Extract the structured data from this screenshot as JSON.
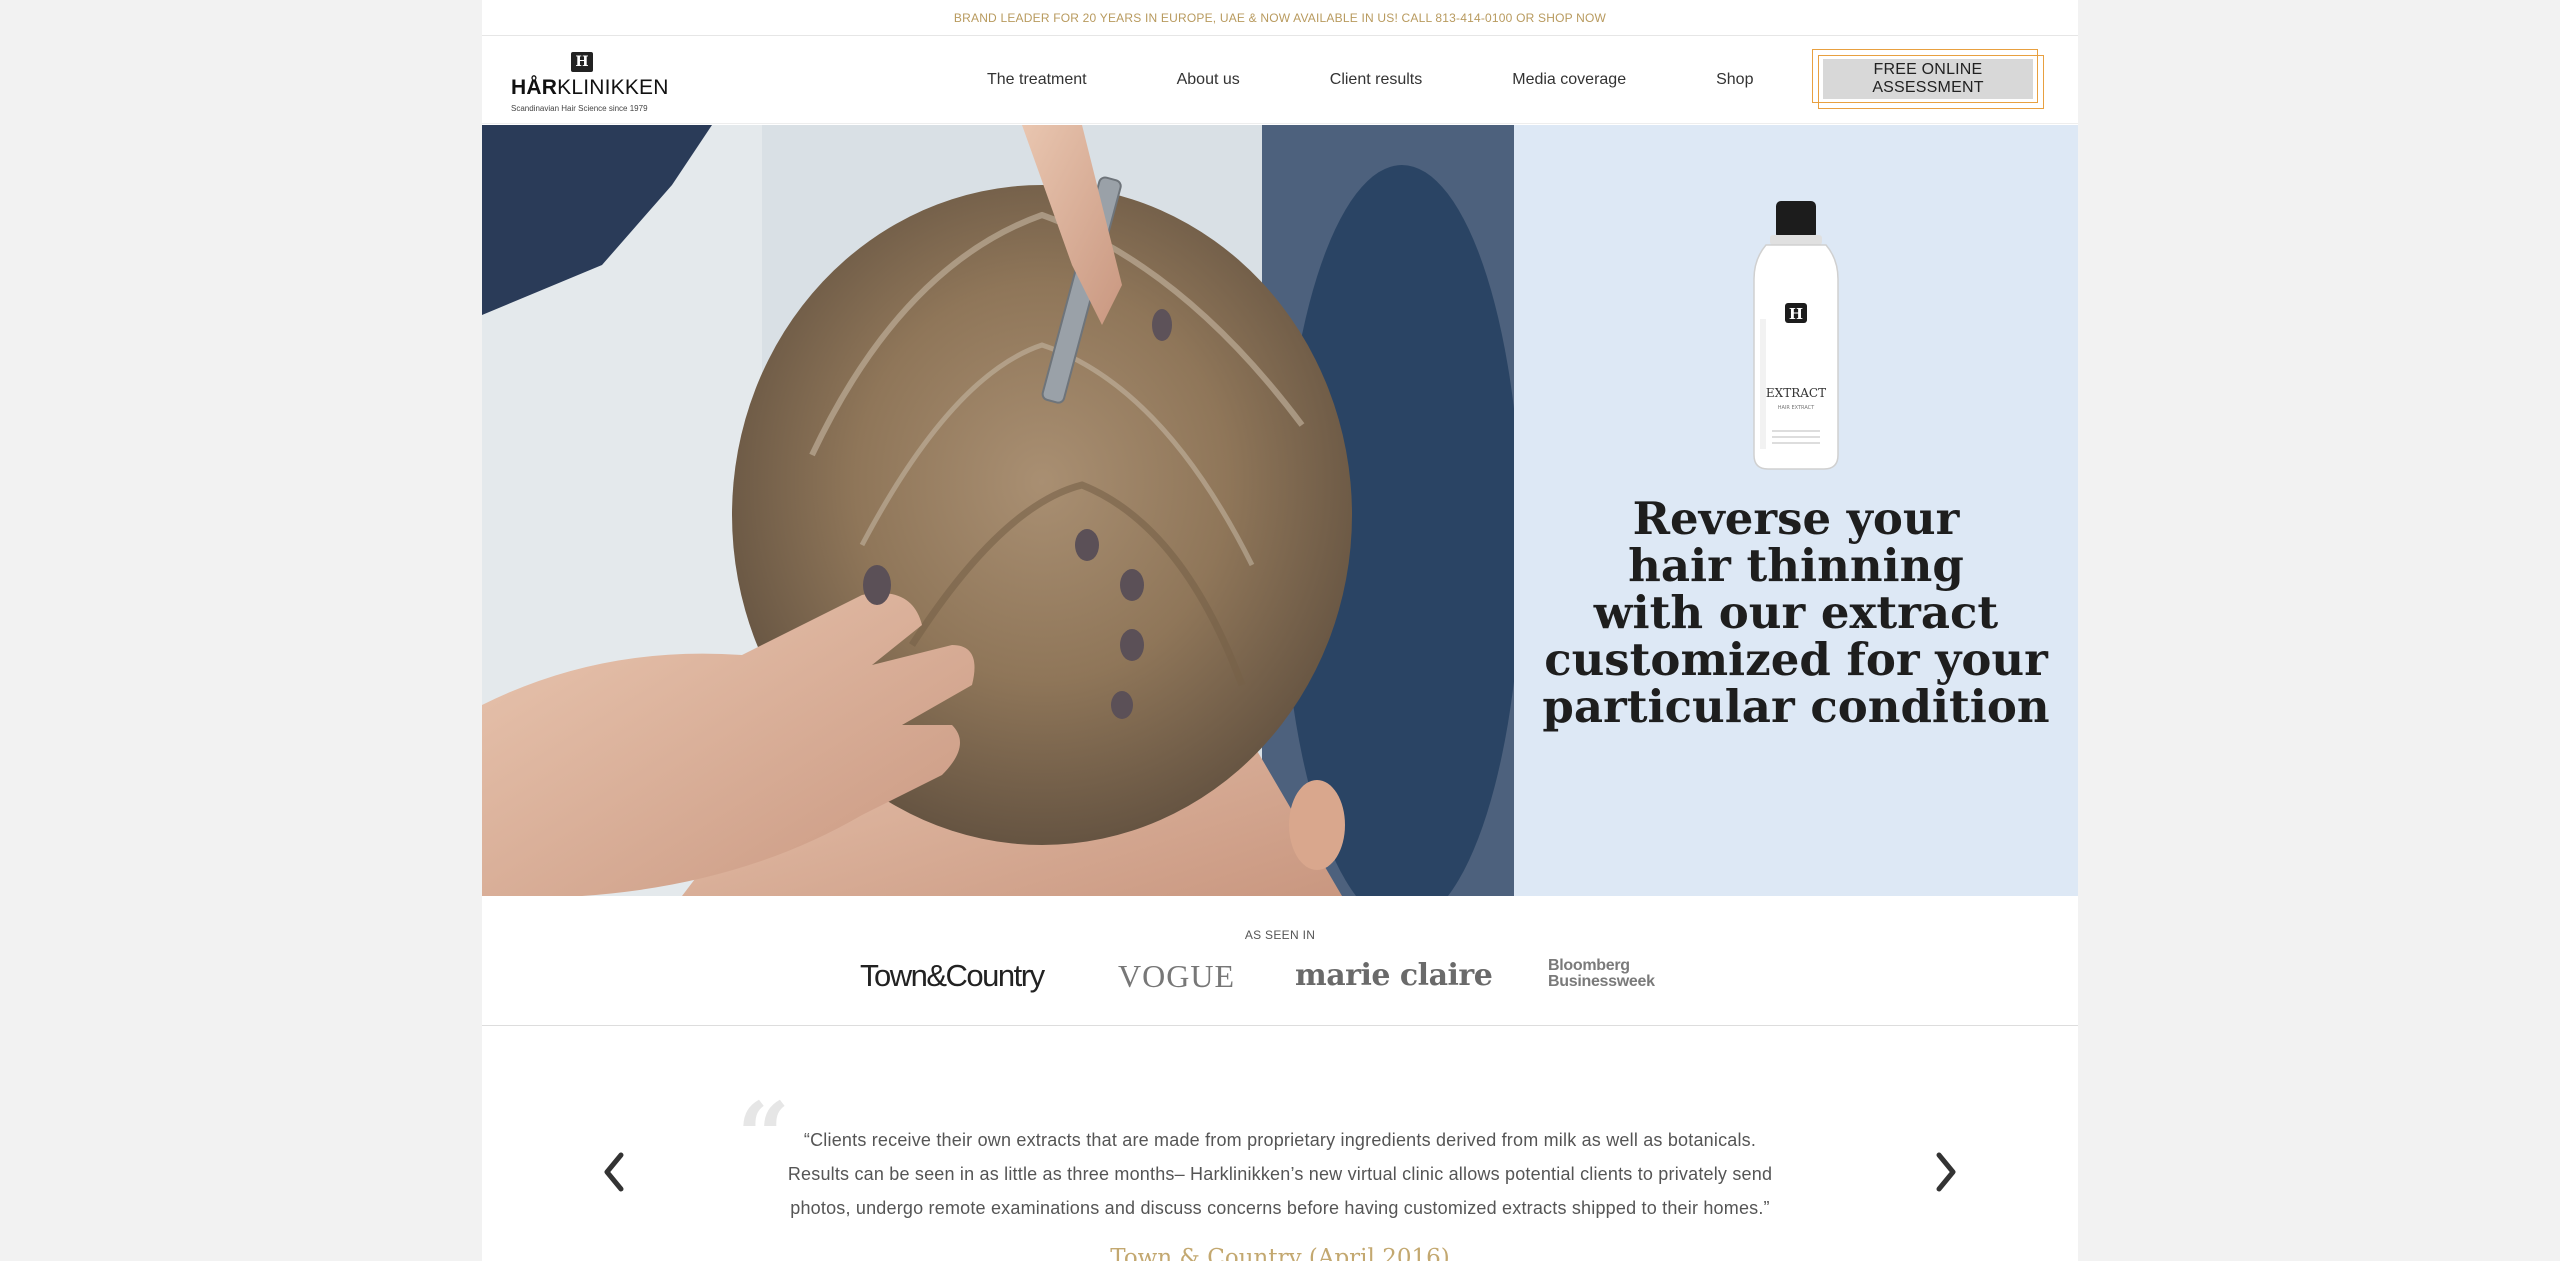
{
  "topbar": {
    "text": "BRAND LEADER FOR 20 YEARS IN EUROPE, UAE & NOW AVAILABLE IN US! CALL 813-414-0100 OR SHOP NOW"
  },
  "logo": {
    "badge": "H",
    "word_bold": "HÅR",
    "word_rest": "KLINIKKEN",
    "tagline": "Scandinavian Hair Science since 1979"
  },
  "nav": {
    "items": [
      {
        "label": "The treatment"
      },
      {
        "label": "About us"
      },
      {
        "label": "Client results"
      },
      {
        "label": "Media coverage"
      },
      {
        "label": "Shop"
      }
    ],
    "cta_label": "FREE ONLINE ASSESSMENT"
  },
  "hero": {
    "headline_lines": [
      "Reverse your",
      "hair thinning",
      "with our extract",
      "customized for your",
      "particular condition"
    ],
    "bottle": {
      "badge": "H",
      "label": "EXTRACT",
      "sublabel": "HAIR EXTRACT"
    }
  },
  "as_seen_in": {
    "title": "AS SEEN IN",
    "logos": [
      {
        "name": "Town&Country"
      },
      {
        "name": "VOGUE"
      },
      {
        "name": "marie claire"
      },
      {
        "line1": "Bloomberg",
        "line2": "Businessweek"
      }
    ]
  },
  "testimonial": {
    "quote_mark": "“",
    "text": "“Clients receive their own extracts that are made from proprietary ingredients derived from milk as well as botanicals. Results can be seen in as little as three months– Harklinikken’s new virtual clinic allows potential clients to privately send photos, undergo remote examinations and discuss concerns before having customized extracts shipped to their homes.”",
    "source": "Town & Country (April 2016)"
  },
  "colors": {
    "accent_gold": "#b89a5e",
    "hero_panel": "#dde8f5",
    "cta_outline": "#e8a040"
  }
}
